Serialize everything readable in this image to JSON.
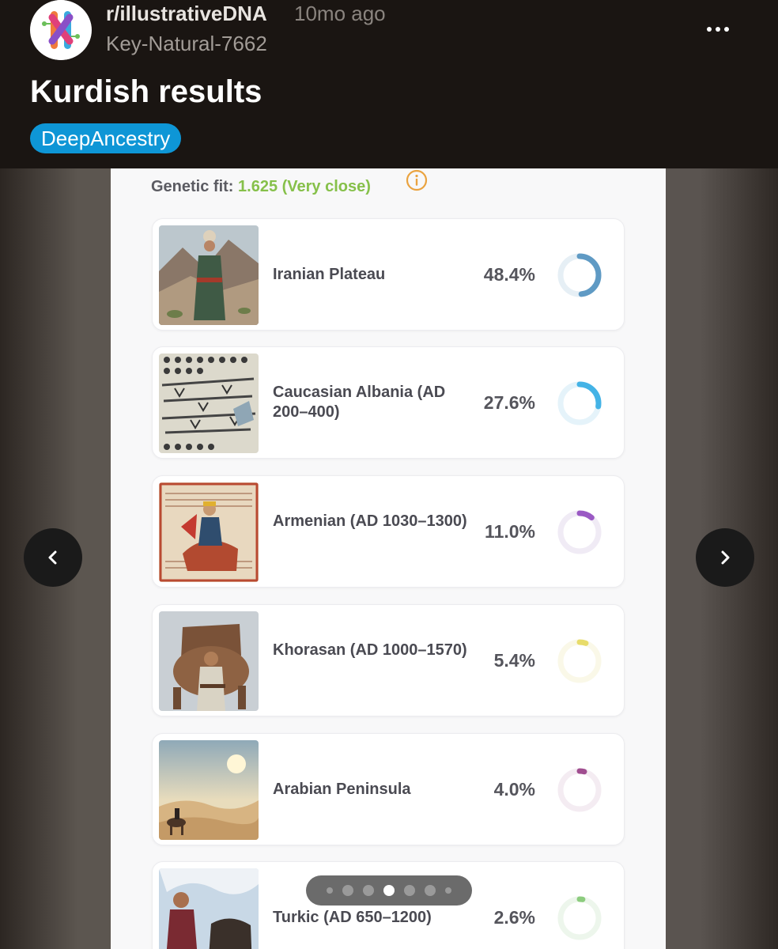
{
  "post": {
    "subreddit": "r/illustrativeDNA",
    "time_ago": "10mo ago",
    "author": "Key-Natural-7662",
    "title": "Kurdish results",
    "flair": "DeepAncestry"
  },
  "result": {
    "fit_label": "Genetic fit:",
    "fit_value": "1.625 (Very close)"
  },
  "populations": [
    {
      "label": "Iranian Plateau",
      "percent": "48.4%",
      "fraction": 0.484,
      "color": "#5f9ac4",
      "track": "#e6eff5"
    },
    {
      "label": "Caucasian Albania (AD 200–400)",
      "percent": "27.6%",
      "fraction": 0.276,
      "color": "#44b3e6",
      "track": "#e5f3fa"
    },
    {
      "label": "Armenian (AD 1030–1300)",
      "percent": "11.0%",
      "fraction": 0.11,
      "color": "#9a59c4",
      "track": "#f0ebf5"
    },
    {
      "label": "Khorasan (AD 1000–1570)",
      "percent": "5.4%",
      "fraction": 0.054,
      "color": "#e8dc6a",
      "track": "#faf8e8"
    },
    {
      "label": "Arabian Peninsula",
      "percent": "4.0%",
      "fraction": 0.04,
      "color": "#a04e90",
      "track": "#f4ecf2"
    },
    {
      "label": "Turkic (AD 650–1200)",
      "percent": "2.6%",
      "fraction": 0.026,
      "color": "#8ccc7e",
      "track": "#edf6ec"
    }
  ],
  "gallery": {
    "slide_count": 7,
    "current_index": 3
  },
  "icons": {
    "more": "more-dots-icon",
    "info": "info-icon",
    "prev": "chevron-left-icon",
    "next": "chevron-right-icon"
  }
}
